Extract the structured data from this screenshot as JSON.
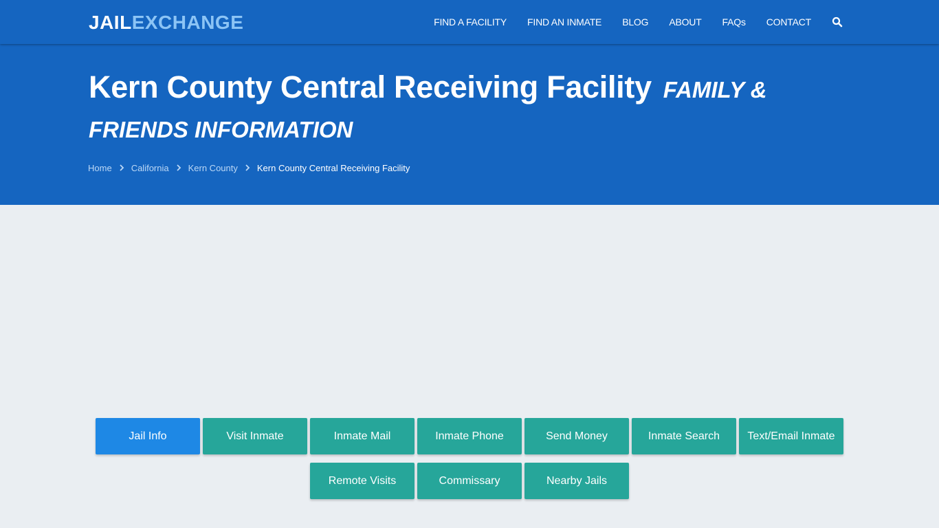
{
  "header": {
    "logo": {
      "part1": "JAIL",
      "part2": "EXCHANGE"
    },
    "nav": [
      {
        "label": "FIND A FACILITY"
      },
      {
        "label": "FIND AN INMATE"
      },
      {
        "label": "BLOG"
      },
      {
        "label": "ABOUT"
      },
      {
        "label": "FAQs"
      },
      {
        "label": "CONTACT"
      }
    ],
    "search_icon": "search-icon"
  },
  "hero": {
    "title": "Kern County Central Receiving Facility",
    "subtitle": "FAMILY & FRIENDS INFORMATION",
    "breadcrumb": [
      {
        "label": "Home"
      },
      {
        "label": "California"
      },
      {
        "label": "Kern County"
      },
      {
        "label": "Kern County Central Receiving Facility"
      }
    ]
  },
  "buttons": [
    {
      "label": "Jail Info",
      "active": true
    },
    {
      "label": "Visit Inmate"
    },
    {
      "label": "Inmate Mail"
    },
    {
      "label": "Inmate Phone"
    },
    {
      "label": "Send Money"
    },
    {
      "label": "Inmate Search"
    },
    {
      "label": "Text/Email Inmate"
    },
    {
      "label": "Remote Visits"
    },
    {
      "label": "Commissary"
    },
    {
      "label": "Nearby Jails"
    }
  ],
  "colors": {
    "brand_blue": "#1565c0",
    "logo_accent": "#8cc4f5",
    "button_teal": "#26a69a",
    "button_active": "#1e88e5",
    "page_bg": "#eaeef2"
  }
}
